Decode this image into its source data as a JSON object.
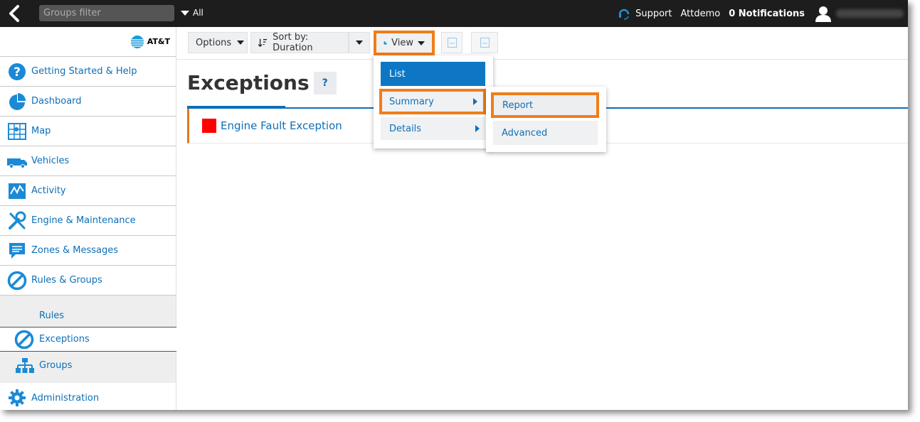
{
  "topbar": {
    "groups_filter_placeholder": "Groups filter",
    "all_label": "All",
    "support_label": "Support",
    "account_label": "Attdemo",
    "notifications_label": "0 Notifications"
  },
  "sidebar": {
    "logo_text": "AT&T",
    "items": [
      {
        "label": "Getting Started & Help",
        "icon": "help-circle-icon"
      },
      {
        "label": "Dashboard",
        "icon": "pie-chart-icon"
      },
      {
        "label": "Map",
        "icon": "map-grid-icon"
      },
      {
        "label": "Vehicles",
        "icon": "truck-icon"
      },
      {
        "label": "Activity",
        "icon": "activity-chart-icon"
      },
      {
        "label": "Engine & Maintenance",
        "icon": "wrench-icon"
      },
      {
        "label": "Zones & Messages",
        "icon": "message-icon"
      },
      {
        "label": "Rules & Groups",
        "icon": "prohibited-icon"
      }
    ],
    "sub_items": {
      "rules": "Rules",
      "exceptions": "Exceptions",
      "groups": "Groups"
    },
    "admin_label": "Administration"
  },
  "toolbar": {
    "options_label": "Options",
    "sort_label": "Sort by: Duration",
    "view_label": "View"
  },
  "main": {
    "title": "Exceptions",
    "help_label": "?",
    "exception_name": "Engine Fault Exception",
    "exception_color": "#ff0000"
  },
  "view_menu": {
    "list": "List",
    "summary": "Summary",
    "details": "Details"
  },
  "summary_submenu": {
    "report": "Report",
    "advanced": "Advanced"
  },
  "colors": {
    "accent_blue": "#0d6fb8",
    "highlight_orange": "#f07d19",
    "topbar_bg": "#1d1d1d"
  }
}
